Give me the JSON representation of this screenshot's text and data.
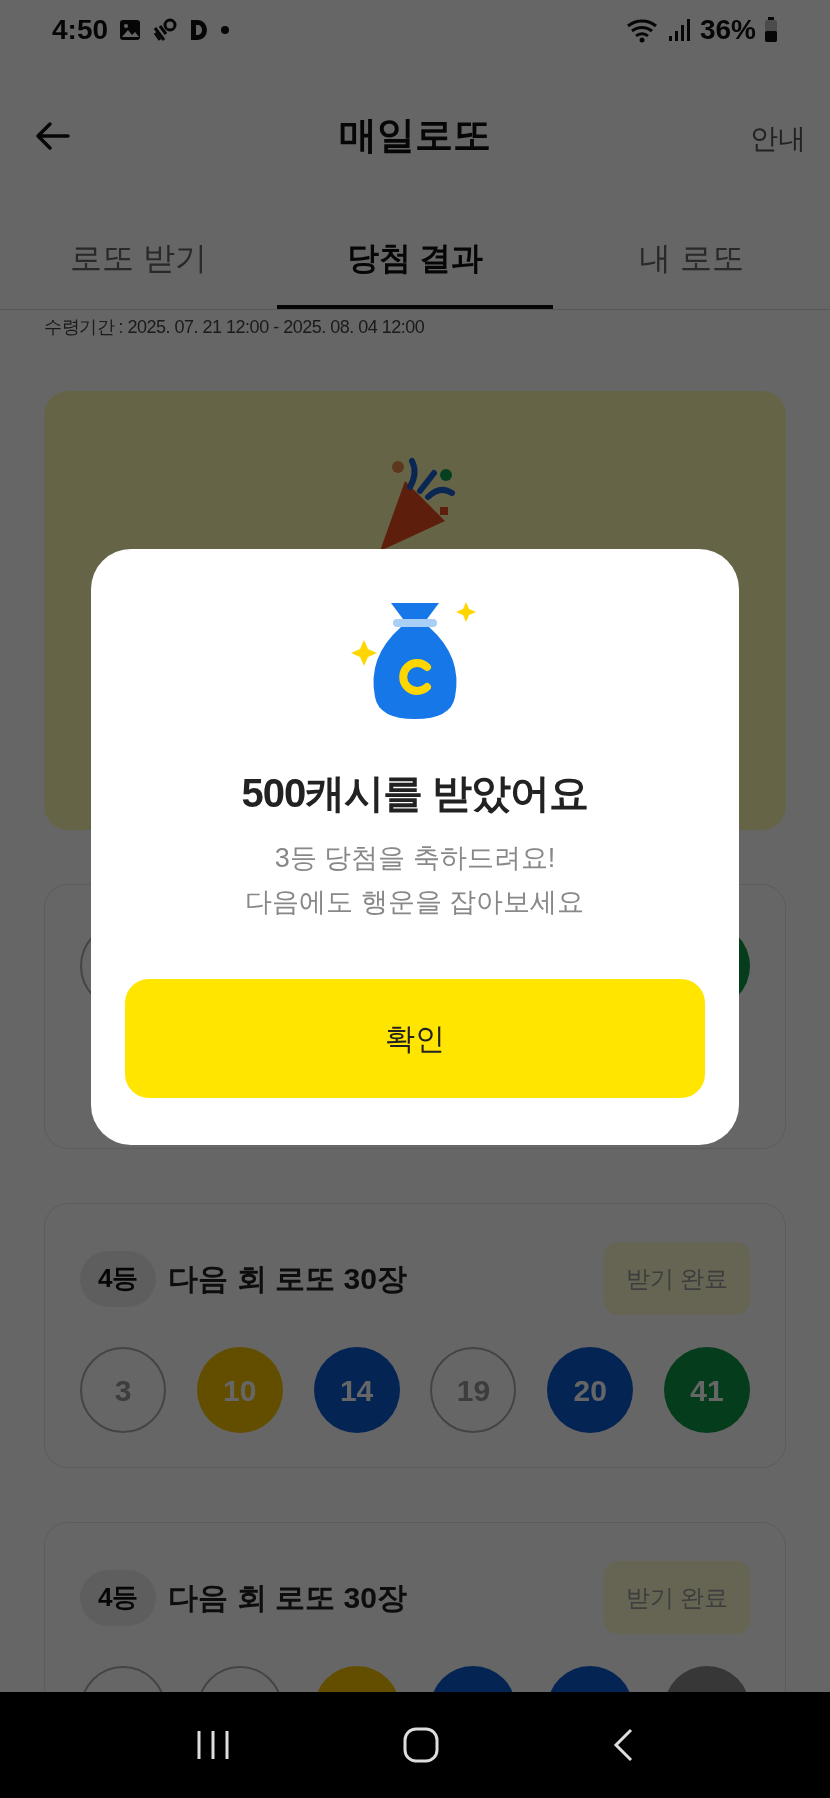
{
  "status_bar": {
    "time": "4:50",
    "battery": "36%"
  },
  "header": {
    "title": "매일로또",
    "action": "안내"
  },
  "tabs": [
    {
      "label": "로또 받기",
      "selected": false
    },
    {
      "label": "당첨 결과",
      "selected": true
    },
    {
      "label": "내 로또",
      "selected": false
    }
  ],
  "period": "수령기간 : 2025. 07. 21 12:00 - 2025. 08. 04 12:00",
  "cards": [
    {
      "kind": "banner"
    },
    {
      "kind": "result",
      "balls": [
        {
          "kind": "outline"
        },
        {
          "kind": "green"
        }
      ]
    },
    {
      "kind": "result",
      "rank": "4등",
      "prize": "다음 회 로또 30장",
      "button": "받기 완료",
      "balls": [
        {
          "kind": "outline",
          "number": "3"
        },
        {
          "kind": "yellow",
          "number": "10"
        },
        {
          "kind": "blue",
          "number": "14"
        },
        {
          "kind": "outline",
          "number": "19"
        },
        {
          "kind": "blue",
          "number": "20"
        },
        {
          "kind": "green",
          "number": "41"
        }
      ]
    },
    {
      "kind": "result",
      "rank": "4등",
      "prize": "다음 회 로또 30장",
      "button": "받기 완료",
      "balls": [
        {
          "kind": "outline"
        },
        {
          "kind": "outline"
        },
        {
          "kind": "yellow"
        },
        {
          "kind": "blue"
        },
        {
          "kind": "blue"
        },
        {
          "kind": "gray"
        }
      ]
    }
  ],
  "dialog": {
    "title": "500캐시를 받았어요",
    "message": [
      "3등 당첨을 축하드려요!",
      "다음에도 행운을 잡아보세요"
    ],
    "button": "확인"
  }
}
